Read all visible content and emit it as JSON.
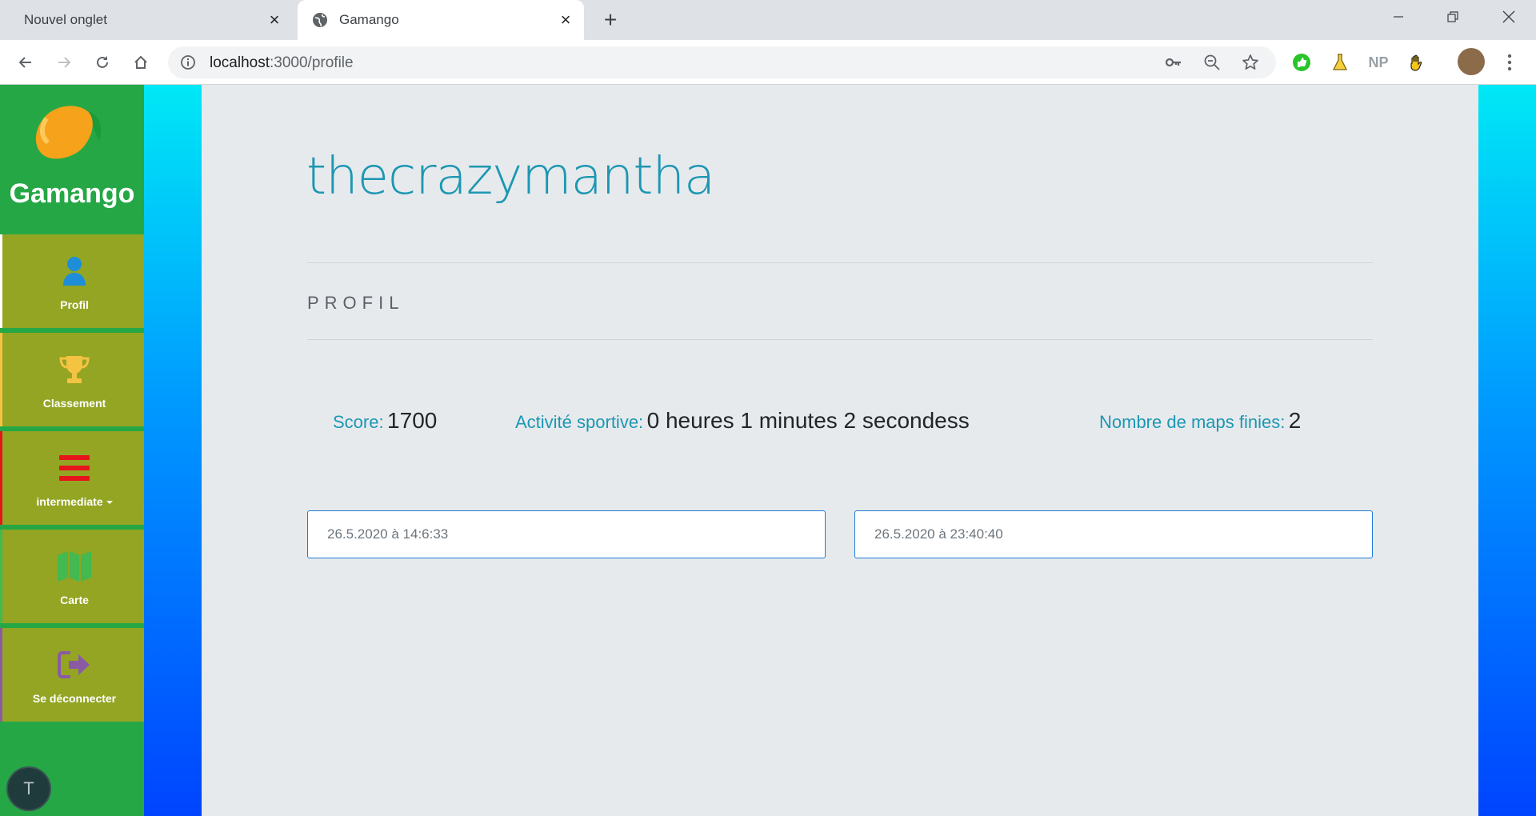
{
  "browser": {
    "tabs": [
      {
        "title": "Nouvel onglet",
        "active": false
      },
      {
        "title": "Gamango",
        "active": true
      }
    ],
    "url_host": "localhost",
    "url_port_path": ":3000/profile",
    "extensions": [
      "thumbs-up-icon",
      "flask-icon",
      "np-icon",
      "hand-icon"
    ],
    "ext_np_label": "NP"
  },
  "sidebar": {
    "brand": "Gamango",
    "items": [
      {
        "label": "Profil",
        "icon": "user-icon",
        "color": "#1f8ed8"
      },
      {
        "label": "Classement",
        "icon": "trophy-icon",
        "color": "#f5c342"
      },
      {
        "label": "intermediate",
        "icon": "menu-icon",
        "color": "#e8141c",
        "dropdown": true
      },
      {
        "label": "Carte",
        "icon": "map-icon",
        "color": "#43b94f"
      },
      {
        "label": "Se déconnecter",
        "icon": "sign-out-icon",
        "color": "#8a5aa5"
      }
    ],
    "avatar_letter": "T"
  },
  "profile": {
    "username": "thecrazymantha",
    "section_title": "PROFIL",
    "stats": {
      "score_label": "Score:",
      "score_value": "1700",
      "activity_label": "Activité sportive:",
      "activity_value": "0 heures 1 minutes 2 secondess",
      "maps_label": "Nombre de maps finies:",
      "maps_value": "2"
    },
    "dates": [
      "26.5.2020 à 14:6:33",
      "26.5.2020 à 23:40:40"
    ]
  },
  "colors": {
    "sidebar_bg": "#25a745",
    "nav_item_bg": "#93a523",
    "accent_text": "#1c97b2",
    "content_bg": "#e7eaed"
  }
}
